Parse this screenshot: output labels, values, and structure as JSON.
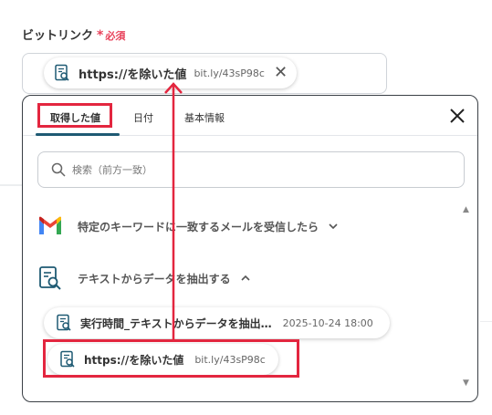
{
  "field": {
    "label": "ビットリンク",
    "required_mark": "*",
    "required_text": "必須"
  },
  "selected_chip": {
    "main": "https://を除いた値",
    "sub": "bit.ly/43sP98c",
    "close_symbol": "✕"
  },
  "popup": {
    "tabs": [
      {
        "label": "取得した値",
        "active": true
      },
      {
        "label": "日付",
        "active": false
      },
      {
        "label": "基本情報",
        "active": false
      }
    ],
    "search": {
      "placeholder": "検索（前方一致）"
    },
    "sections": [
      {
        "title": "特定のキーワードに一致するメールを受信したら",
        "expanded": false,
        "icon": "gmail-icon"
      },
      {
        "title": "テキストからデータを抽出する",
        "expanded": true,
        "icon": "document-search-icon"
      }
    ],
    "items": [
      {
        "main": "実行時間_テキストからデータを抽出…",
        "sub": "2025-10-24 18:00"
      },
      {
        "main": "https://を除いた値",
        "sub": "bit.ly/43sP98c"
      }
    ]
  },
  "colors": {
    "accent": "#1e5a73",
    "required": "#e8425b",
    "highlight": "#e3263f"
  }
}
